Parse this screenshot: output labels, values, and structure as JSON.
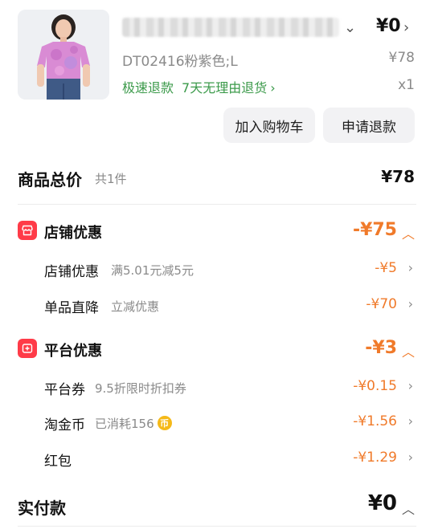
{
  "product": {
    "sku": "DT02416粉紫色;L",
    "unit_price": "¥78",
    "paid_price": "¥0",
    "tags": [
      "极速退款",
      "7天无理由退货"
    ],
    "quantity": "x1",
    "actions": {
      "add_to_cart": "加入购物车",
      "request_refund": "申请退款"
    }
  },
  "summary": {
    "total_label": "商品总价",
    "total_count": "共1件",
    "total_value": "¥78"
  },
  "shop_discount": {
    "title": "店铺优惠",
    "value": "-¥75",
    "items": [
      {
        "label": "店铺优惠",
        "sub": "满5.01元减5元",
        "value": "-¥5"
      },
      {
        "label": "单品直降",
        "sub": "立减优惠",
        "value": "-¥70"
      }
    ]
  },
  "platform_discount": {
    "title": "平台优惠",
    "value": "-¥3",
    "items": [
      {
        "label": "平台券",
        "sub": "9.5折限时折扣券",
        "value": "-¥0.15"
      },
      {
        "label": "淘金币",
        "sub": "已消耗156",
        "value": "-¥1.56"
      },
      {
        "label": "红包",
        "sub": "",
        "value": "-¥1.29"
      }
    ]
  },
  "payment": {
    "label": "实付款",
    "value": "¥0"
  },
  "colors": {
    "accent": "#f07a2a",
    "green": "#3b9a4a",
    "badge": "#ff3b48"
  }
}
